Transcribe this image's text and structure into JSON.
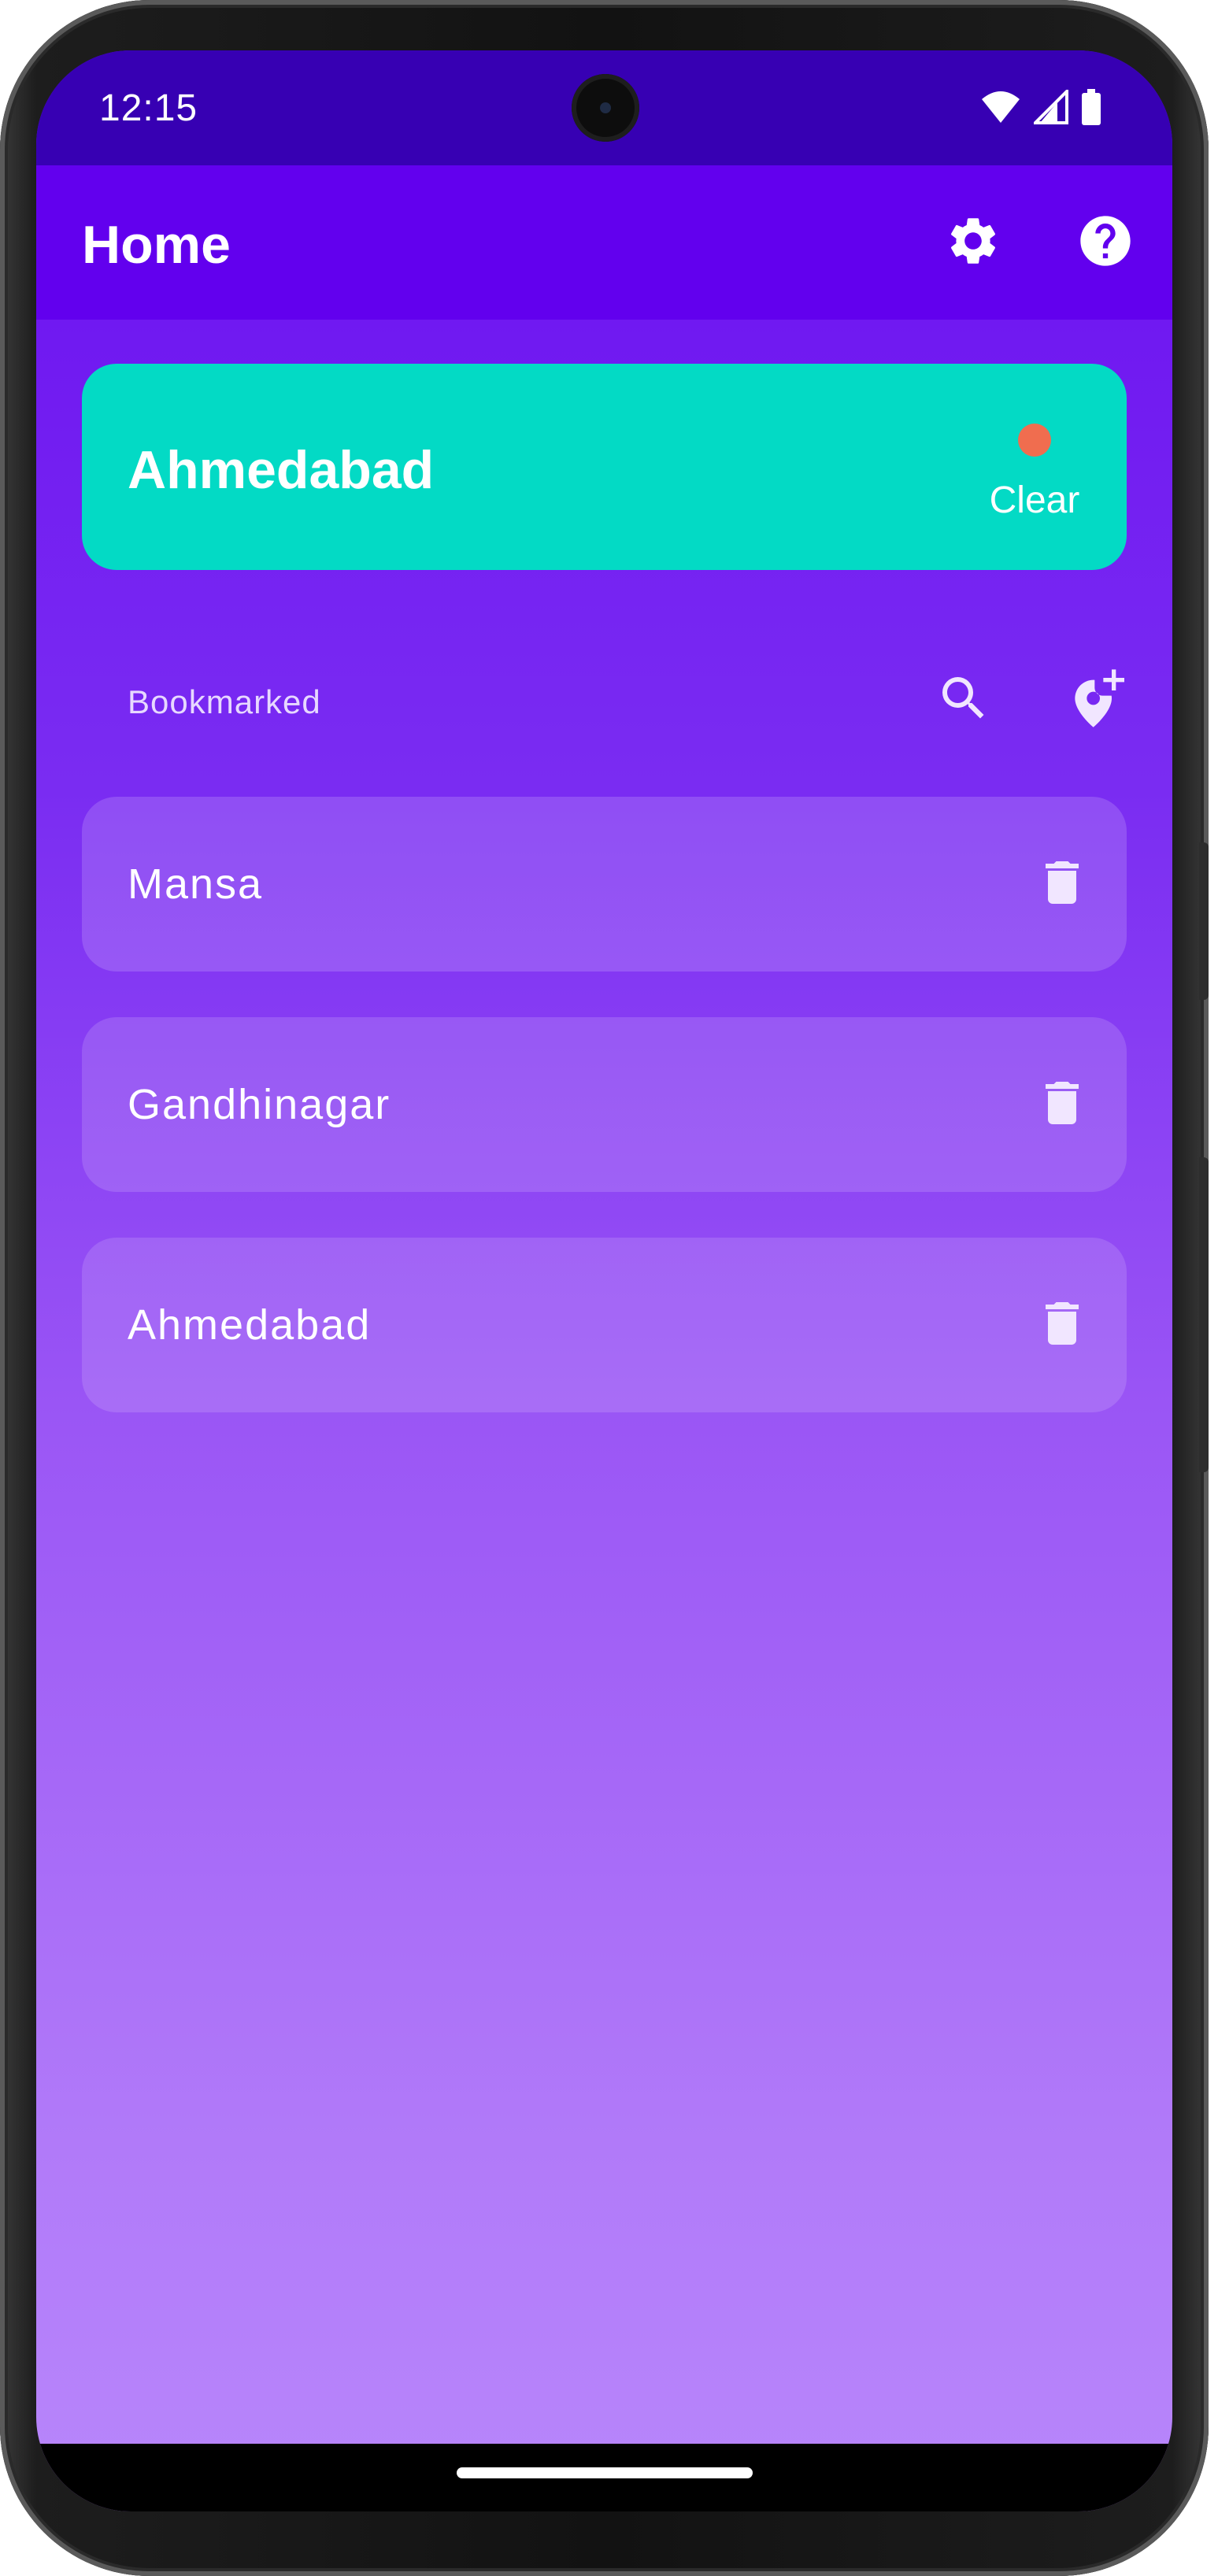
{
  "status_bar": {
    "time": "12:15",
    "icons": [
      "wifi-icon",
      "signal-icon",
      "battery-icon"
    ]
  },
  "app_bar": {
    "title": "Home",
    "actions": [
      "gear-icon",
      "help-icon"
    ]
  },
  "current_location": {
    "city": "Ahmedabad",
    "clear_label": "Clear",
    "indicator_color": "#f06d4f"
  },
  "bookmarks": {
    "header": "Bookmarked",
    "actions": [
      "search-icon",
      "add-location-icon"
    ],
    "items": [
      {
        "label": "Mansa"
      },
      {
        "label": "Gandhinagar"
      },
      {
        "label": "Ahmedabad"
      }
    ]
  },
  "colors": {
    "status_bar": "#3700b3",
    "app_bar": "#6200ee",
    "accent_card": "#03dac5",
    "gradient_top": "#6a0ef0",
    "gradient_bottom": "#b886fb"
  }
}
